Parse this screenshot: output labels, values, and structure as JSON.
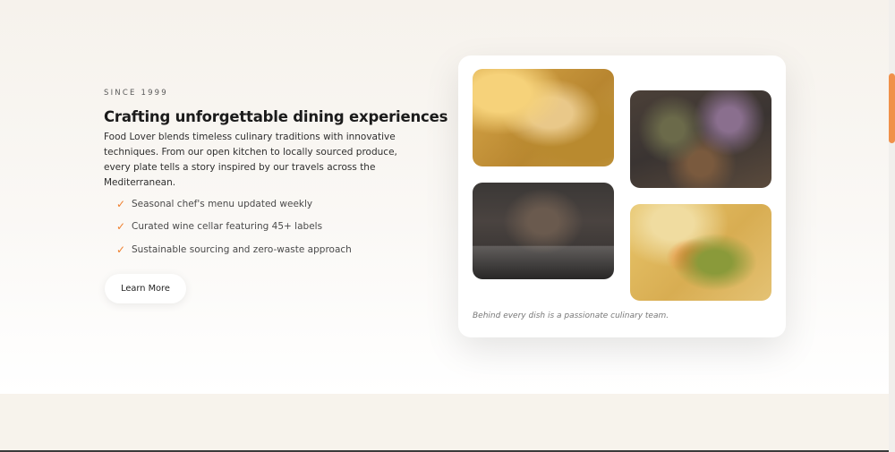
{
  "about": {
    "eyebrow": "SINCE 1999",
    "title": "Crafting unforgettable dining experiences",
    "description": "Food Lover blends timeless culinary traditions with innovative techniques. From our open kitchen to locally sourced produce, every plate tells a story inspired by our travels across the Mediterranean.",
    "features": [
      {
        "icon": "check-icon",
        "check": "✓",
        "label": "Seasonal chef's menu updated weekly"
      },
      {
        "icon": "check-icon",
        "check": "✓",
        "label": "Curated wine cellar featuring 45+ labels"
      },
      {
        "icon": "check-icon",
        "check": "✓",
        "label": "Sustainable sourcing and zero-waste approach"
      }
    ],
    "button_label": "Learn More"
  },
  "gallery": {
    "caption": "Behind every dish is a passionate culinary team."
  },
  "colors": {
    "accent": "#ef7f2c",
    "scroll_thumb": "#f0914a"
  }
}
